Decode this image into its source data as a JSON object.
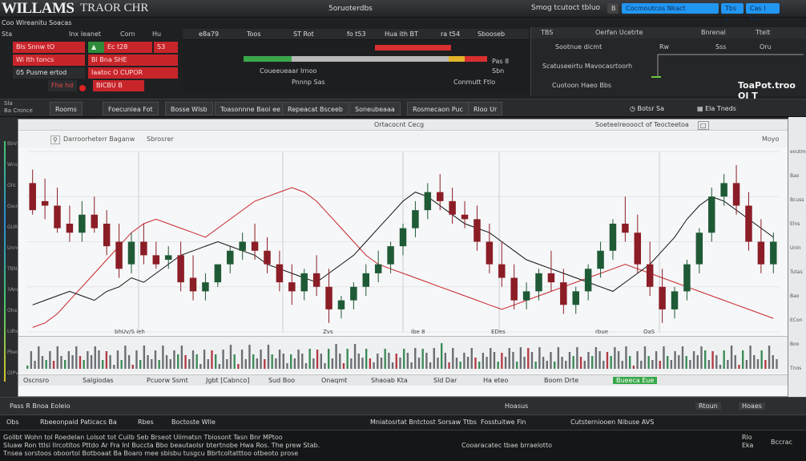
{
  "header": {
    "brand": "WILLAMS",
    "brand_sub": "TRAOR CHR",
    "center_text": "5oruoterdbs",
    "right_text": "Smog tcutoct tbluo",
    "btn_icon": "B",
    "btn_primary": "Cocmoutcos Nkact",
    "btn_tab2": "Tbs a",
    "btn_tab3": "Cas I tro"
  },
  "account": {
    "subline": "Coo Wlreanitu Soacas",
    "line_items": [
      "Sta",
      "Inx Ieanet",
      "Corn",
      "Hu"
    ]
  },
  "order_rows": [
    {
      "a": "Bls  Snnw tO",
      "b": "Ec t28",
      "c": "S3"
    },
    {
      "a": "Wi  Ith toncs",
      "b": "Bl Bna  SHE",
      "c": ""
    },
    {
      "a": "05  Pusme ertod",
      "b": "Iaatoc  O CUPOR",
      "c": ""
    },
    {
      "a": "Fhe  hd",
      "b": "BICBU B",
      "c": ""
    }
  ],
  "ticker": [
    "e8a79",
    "Toos",
    "ST Rot",
    "fo t53",
    "Hua ith BT",
    "ra  t54",
    "Sbooseb"
  ],
  "quote": {
    "label1": "Coueeueaar Irnoo",
    "label2": "Pnnnp Sas",
    "label3": "Conmutt Ftlo",
    "label4": "Sbn",
    "label5": "Pas 8"
  },
  "right_panel": {
    "tab_items": [
      "TBS",
      "Oerfan Ucetrte",
      "Bnrenal",
      "Ttelt"
    ],
    "row1": "Sootnue dicmt",
    "row2": "Scatuseeirtu Mavocasrtoorh",
    "row3": "Cuotoon Haeo Bbs",
    "side1": "Rw",
    "side2": "Sss",
    "side3": "Oru",
    "big": "ToaPot.troo OI T"
  },
  "toolbar": {
    "logo_line1": "Sla",
    "logo_line2": "Ba Cronce",
    "buttons": [
      "Rooms",
      "Foecuniea Fot",
      "Bosse Wlsb",
      "Toasonnne Baoi ee",
      "Repeacat Bsceeb",
      "Soneubeaaa",
      "Rosmecaon Puc",
      "Rloo Ur",
      "Botsr Sa",
      "Ela Tneds"
    ]
  },
  "chart": {
    "header_center": "Ortacocnt Cecg",
    "header_right": "Soeteelreoooct of Teocteetoa",
    "sub_left": "Darroorheterr Baganw",
    "sub_mid": "Sbrosrer",
    "sub_right": "Moyo",
    "time_labels": [
      "bhUv/S ieh",
      "Zvs",
      "Ibe 8",
      "EDes",
      "rbue",
      "OaS"
    ],
    "status_items": [
      "Oscnsro",
      "Salgiodas",
      "Pcuorw Ssmt",
      "Jgbt [Cabnco]",
      "Sud Boo",
      "Onaqmt",
      "Shaoab Kta",
      "Sld Dar",
      "Ha eteo",
      "Boom Drte",
      "Bueeca Eue"
    ]
  },
  "left_axis_labels": [
    "BbVs",
    "Wns",
    "Olic",
    "Oaut",
    "GUR",
    "Unns",
    "TBN",
    "3Ann",
    "Oha",
    "Ldhe",
    "Pbes",
    "OIPv"
  ],
  "right_axis_labels": [
    "eoutmo",
    "Bao",
    "Bcuss",
    "Elns",
    "Unin",
    "Tutas",
    "Bao",
    "ECon",
    "Boo",
    "Tnos"
  ],
  "order_bar": [
    "Pass R  Bnoa  Eoleio",
    "Hoasus",
    "Rtoun",
    "Hoaes"
  ],
  "tabs_row": [
    "Obs",
    "Rbeeonpaid Paticacs Ba",
    "Rbes",
    "Boctoste Wlle",
    "Mniatosrtat Bntctost Sorsaw Ttbs",
    "Fosstuitwe Fin",
    "Cutsterniooen Nibuse AVS"
  ],
  "log": [
    "Gollbt Wohn tol Roedelan Lolsot tot Cuilb Seb Brseot Uiimatsn Tbiosont Tasn Bnr MPtoo",
    "Sluaw Ron ttlsi llrcotitos Pttdo Ar Fra Inl Buccta Bbo beautaolsr btertnobe Hwa Ros. The prew Stab.",
    "Tnsea sorstoos oboortol Botboaat Ba Boaro mee sbisbu tusgcu Bbrtcoltatttoo otbeoto prose",
    "Cooaracatec tbae brraelotto",
    "Rlo",
    "Eka",
    "Bccrac"
  ],
  "chart_data": {
    "type": "line",
    "note_candles": "OHLC candles plus two overlay lines (black, red); values approximate",
    "candles": [
      [
        0,
        66,
        72,
        54,
        52
      ],
      [
        1,
        58,
        68,
        56,
        50
      ],
      [
        2,
        56,
        64,
        46,
        44
      ],
      [
        3,
        48,
        56,
        44,
        40
      ],
      [
        4,
        44,
        58,
        52,
        40
      ],
      [
        5,
        52,
        60,
        46,
        44
      ],
      [
        6,
        48,
        54,
        38,
        34
      ],
      [
        7,
        40,
        48,
        28,
        24
      ],
      [
        8,
        30,
        44,
        40,
        26
      ],
      [
        9,
        40,
        48,
        34,
        30
      ],
      [
        10,
        34,
        40,
        30,
        28
      ],
      [
        11,
        32,
        38,
        34,
        28
      ],
      [
        12,
        34,
        40,
        22,
        18
      ],
      [
        13,
        24,
        34,
        18,
        14
      ],
      [
        14,
        18,
        26,
        22,
        14
      ],
      [
        15,
        22,
        28,
        30,
        20
      ],
      [
        16,
        30,
        38,
        36,
        26
      ],
      [
        17,
        36,
        44,
        40,
        32
      ],
      [
        18,
        40,
        48,
        36,
        32
      ],
      [
        19,
        36,
        42,
        30,
        26
      ],
      [
        20,
        30,
        36,
        22,
        18
      ],
      [
        21,
        22,
        30,
        18,
        12
      ],
      [
        22,
        18,
        28,
        26,
        14
      ],
      [
        23,
        26,
        34,
        20,
        16
      ],
      [
        24,
        20,
        28,
        10,
        4
      ],
      [
        25,
        10,
        16,
        14,
        6
      ],
      [
        26,
        14,
        22,
        20,
        10
      ],
      [
        27,
        20,
        30,
        26,
        16
      ],
      [
        28,
        26,
        36,
        30,
        22
      ],
      [
        29,
        30,
        40,
        38,
        26
      ],
      [
        30,
        38,
        48,
        46,
        34
      ],
      [
        31,
        46,
        58,
        54,
        42
      ],
      [
        32,
        54,
        66,
        62,
        50
      ],
      [
        33,
        62,
        70,
        58,
        54
      ],
      [
        34,
        58,
        64,
        52,
        48
      ],
      [
        35,
        52,
        58,
        50,
        46
      ],
      [
        36,
        50,
        56,
        40,
        36
      ],
      [
        37,
        40,
        48,
        30,
        26
      ],
      [
        38,
        30,
        40,
        24,
        20
      ],
      [
        39,
        24,
        30,
        14,
        10
      ],
      [
        40,
        14,
        22,
        18,
        10
      ],
      [
        41,
        18,
        28,
        26,
        14
      ],
      [
        42,
        26,
        36,
        22,
        18
      ],
      [
        43,
        22,
        28,
        12,
        8
      ],
      [
        44,
        12,
        20,
        18,
        8
      ],
      [
        45,
        18,
        30,
        28,
        14
      ],
      [
        46,
        28,
        40,
        36,
        24
      ],
      [
        47,
        36,
        50,
        48,
        32
      ],
      [
        48,
        48,
        60,
        44,
        40
      ],
      [
        49,
        44,
        52,
        30,
        26
      ],
      [
        50,
        30,
        40,
        20,
        16
      ],
      [
        51,
        20,
        28,
        10,
        4
      ],
      [
        52,
        10,
        20,
        18,
        6
      ],
      [
        53,
        18,
        32,
        30,
        14
      ],
      [
        54,
        30,
        46,
        44,
        26
      ],
      [
        55,
        44,
        64,
        60,
        40
      ],
      [
        56,
        60,
        70,
        66,
        56
      ],
      [
        57,
        66,
        74,
        56,
        52
      ],
      [
        58,
        56,
        62,
        40,
        36
      ],
      [
        59,
        40,
        50,
        30,
        26
      ],
      [
        60,
        30,
        44,
        40,
        26
      ]
    ],
    "line_black": [
      12,
      14,
      16,
      18,
      16,
      14,
      18,
      20,
      24,
      22,
      26,
      30,
      34,
      36,
      38,
      40,
      38,
      36,
      34,
      30,
      28,
      26,
      24,
      22,
      26,
      30,
      34,
      40,
      46,
      52,
      58,
      62,
      60,
      56,
      52,
      48,
      46,
      44,
      40,
      36,
      32,
      30,
      28,
      26,
      24,
      22,
      20,
      18,
      22,
      26,
      30,
      36,
      42,
      50,
      56,
      60,
      58,
      54,
      50,
      46,
      42
    ],
    "line_red": [
      2,
      4,
      8,
      14,
      20,
      26,
      32,
      38,
      44,
      48,
      50,
      48,
      46,
      44,
      42,
      46,
      50,
      54,
      58,
      60,
      62,
      64,
      62,
      58,
      52,
      46,
      40,
      34,
      30,
      28,
      26,
      24,
      22,
      20,
      18,
      16,
      14,
      12,
      10,
      12,
      14,
      16,
      18,
      20,
      22,
      24,
      26,
      28,
      30,
      28,
      26,
      24,
      22,
      20,
      18,
      16,
      14,
      12,
      10,
      8,
      6
    ],
    "ylim": [
      0,
      80
    ],
    "grid": true
  },
  "colors": {
    "up_candle": "#1f5a36",
    "down_candle": "#8b1d26",
    "red_accent": "#c8252b",
    "blue_accent": "#2196f3"
  }
}
